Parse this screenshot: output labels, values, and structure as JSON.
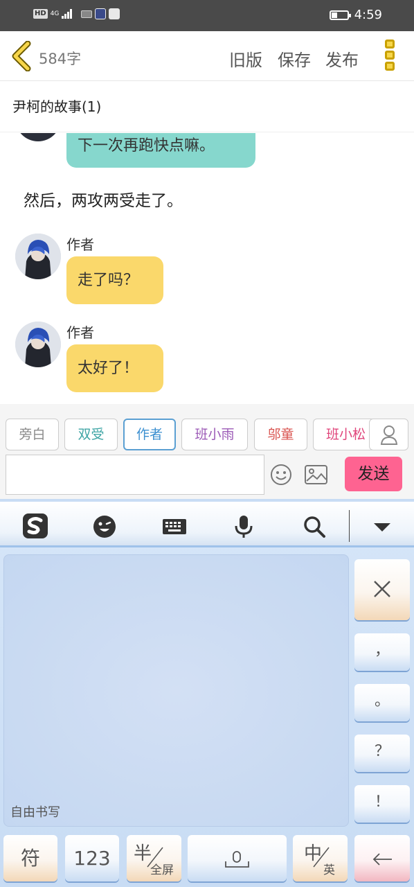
{
  "status_bar": {
    "hd": "HD",
    "network": "4G",
    "time": "4:59"
  },
  "header": {
    "word_count": "584字",
    "old_version": "旧版",
    "save": "保存",
    "publish": "发布"
  },
  "story_title": "尹柯的故事(1)",
  "chat": {
    "partial_message": "下一次再跑快点嘛。",
    "narration": "然后，两攻两受走了。",
    "messages": [
      {
        "speaker": "作者",
        "text": "走了吗？"
      },
      {
        "speaker": "作者",
        "text": "太好了！"
      }
    ]
  },
  "characters": [
    {
      "name": "旁白",
      "color": "#8a8a8a"
    },
    {
      "name": "双受",
      "color": "#3fa5a5"
    },
    {
      "name": "作者",
      "color": "#3b8fd0"
    },
    {
      "name": "班小雨",
      "color": "#9b59b6"
    },
    {
      "name": "邬童",
      "color": "#d9534f"
    },
    {
      "name": "班小松",
      "color": "#e0457b"
    }
  ],
  "input": {
    "send": "发送"
  },
  "keyboard": {
    "handwriting_label": "自由书写",
    "side_keys": [
      "，",
      "。",
      "？",
      "！"
    ],
    "bottom": {
      "symbols": "符",
      "numbers": "123",
      "half": "半",
      "full": "全屏",
      "zh": "中",
      "en": "英"
    }
  },
  "colors": {
    "accent_yellow": "#f7d64a",
    "send_pink": "#fe6391",
    "bubble_teal": "#86d7cd",
    "bubble_yellow": "#fad86b"
  }
}
